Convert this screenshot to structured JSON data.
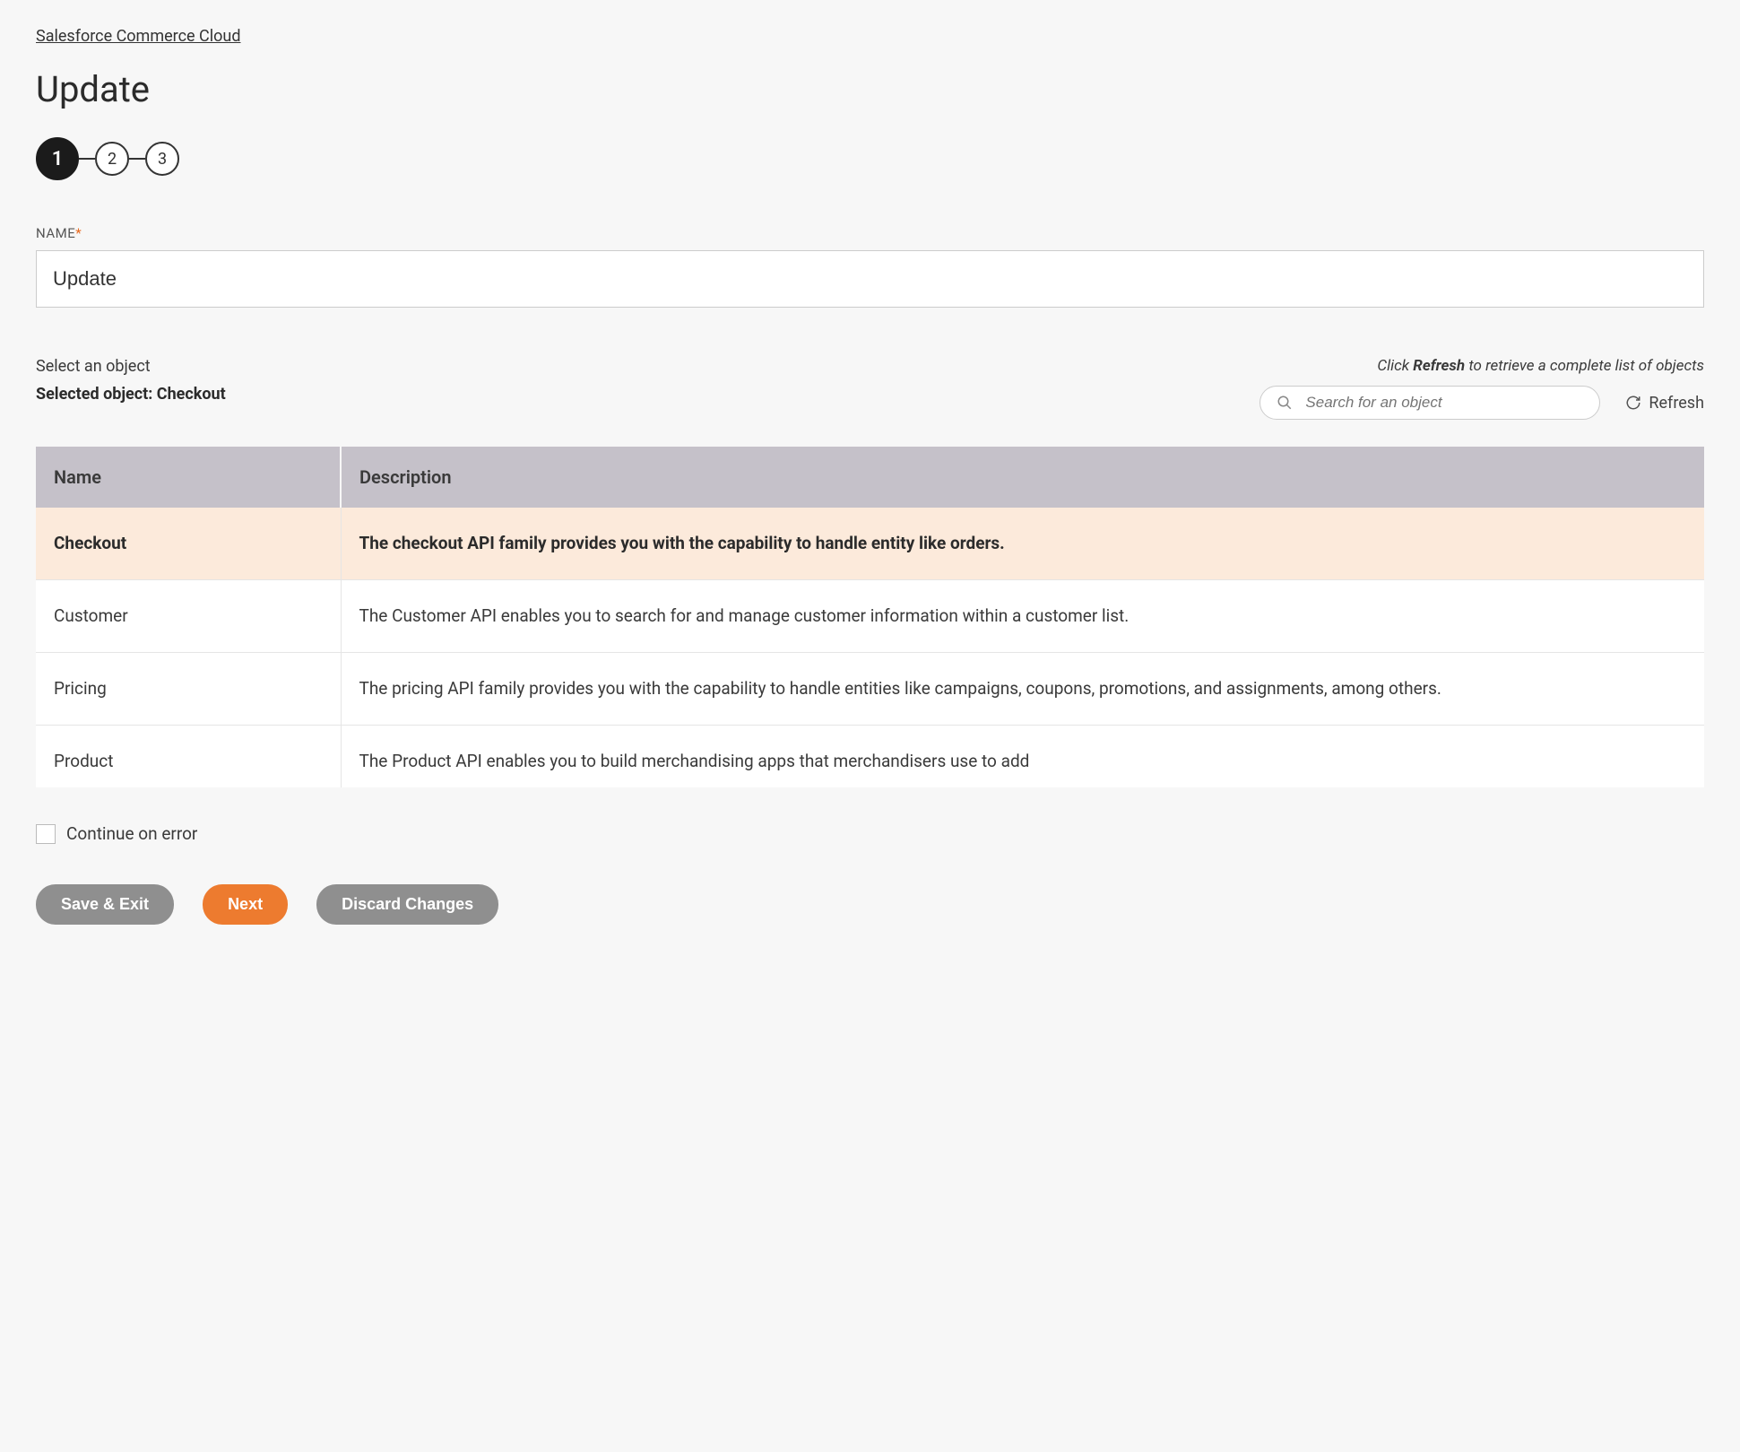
{
  "breadcrumb": "Salesforce Commerce Cloud",
  "page_title": "Update",
  "stepper": {
    "steps": [
      "1",
      "2",
      "3"
    ],
    "active_index": 0
  },
  "name_field": {
    "label": "NAME",
    "required_mark": "*",
    "value": "Update"
  },
  "object_section": {
    "select_label": "Select an object",
    "selected_prefix": "Selected object: ",
    "selected_value": "Checkout",
    "refresh_hint_pre": "Click ",
    "refresh_hint_bold": "Refresh",
    "refresh_hint_post": " to retrieve a complete list of objects",
    "search_placeholder": "Search for an object",
    "refresh_label": "Refresh"
  },
  "table": {
    "headers": {
      "name": "Name",
      "description": "Description"
    },
    "rows": [
      {
        "name": "Checkout",
        "description": "The checkout API family provides you with the capability to handle entity like orders.",
        "selected": true
      },
      {
        "name": "Customer",
        "description": "The Customer API enables you to search for and manage customer information within a customer list.",
        "selected": false
      },
      {
        "name": "Pricing",
        "description": "The pricing API family provides you with the capability to handle entities like campaigns, coupons, promotions, and assignments, among others.",
        "selected": false
      },
      {
        "name": "Product",
        "description": "The Product API enables you to build merchandising apps that merchandisers use to add",
        "selected": false
      }
    ]
  },
  "continue_on_error": {
    "label": "Continue on error",
    "checked": false
  },
  "buttons": {
    "save_exit": "Save & Exit",
    "next": "Next",
    "discard": "Discard Changes"
  }
}
